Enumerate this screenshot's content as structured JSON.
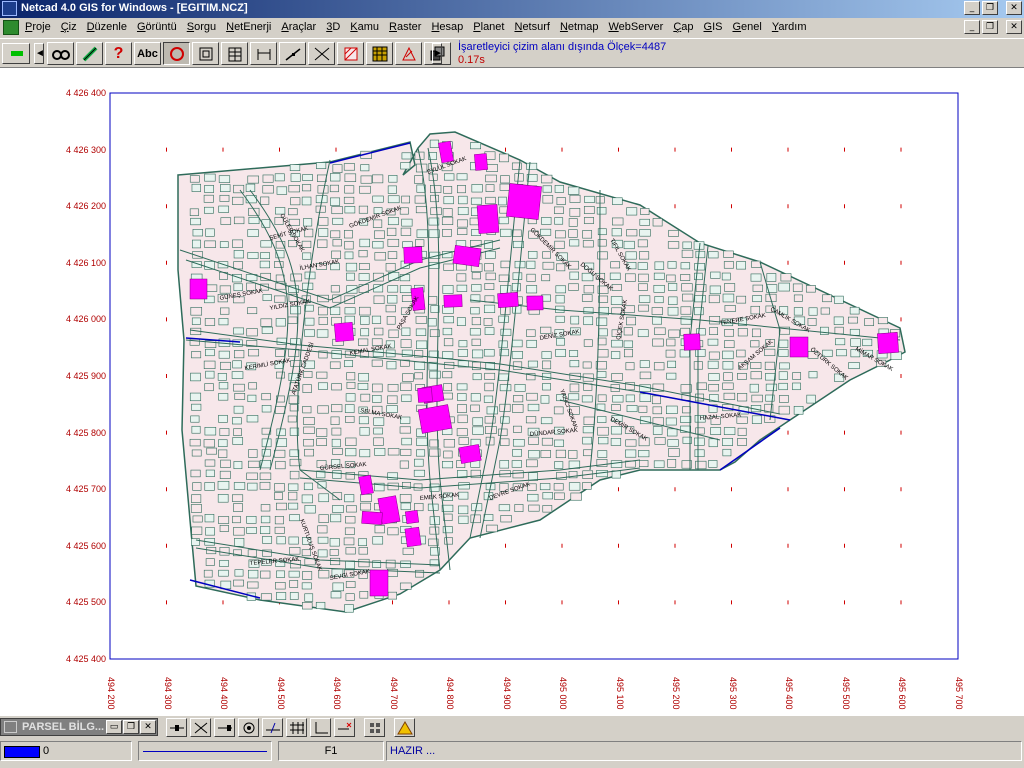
{
  "window": {
    "title": "Netcad 4.0 GIS for Windows - [EGITIM.NCZ]",
    "minimize": "_",
    "restore": "❐",
    "close": "✕"
  },
  "menu": [
    "Proje",
    "Çiz",
    "Düzenle",
    "Görüntü",
    "Sorgu",
    "NetEnerji",
    "Araçlar",
    "3D",
    "Kamu",
    "Raster",
    "Hesap",
    "Planet",
    "Netsurf",
    "Netmap",
    "WebServer",
    "Çap",
    "GIS",
    "Genel",
    "Yardım"
  ],
  "toolbar": {
    "prev_arrow": "◄",
    "next_arrow": "►",
    "abc_label": "Abc",
    "help_label": "?",
    "status_message": "İşaretleyici çizim alanı dışında Ölçek=4487",
    "timing": "0.17s"
  },
  "icons": [
    "binoculars-icon",
    "pencil-icon",
    "help-icon",
    "text-icon",
    "circle-icon",
    "frame-icon",
    "grid-icon",
    "dimension-icon",
    "line-icon",
    "intersect-icon",
    "hatch-icon",
    "raster-icon",
    "polygon-icon",
    "layers-icon"
  ],
  "axes": {
    "y_ticks": [
      "4 426 400",
      "4 426 300",
      "4 426 200",
      "4 426 100",
      "4 426 000",
      "4 425 900",
      "4 425 800",
      "4 425 700",
      "4 425 600",
      "4 425 500",
      "4 425 400"
    ],
    "x_ticks": [
      "494 200",
      "494 300",
      "494 400",
      "494 500",
      "494 600",
      "494 700",
      "494 800",
      "494 900",
      "495 000",
      "495 100",
      "495 200",
      "495 300",
      "495 400",
      "495 500",
      "495 600",
      "495 700"
    ]
  },
  "map": {
    "colors": {
      "parcel_fill": "#f7e7ea",
      "highlight": "#ff00ff",
      "road_line": "#2e6b5a",
      "axis_red": "#b00000",
      "frame_blue": "#0000c0"
    },
    "street_labels": [
      "EYLÜL SOKAK",
      "GÜLER SOKAK",
      "ŞEHİT SOKAK",
      "İLHAN SOKAK",
      "GÖKDEMİR SOKAK",
      "GÖKDEMİR SOKAK",
      "TIFIL SOKAK",
      "TENERE SOKAK",
      "ÇAMLIK SOKAK",
      "ÖZTÜRK SOKAK",
      "DEVRE SOKAK",
      "DEMİR SOKAK",
      "HAZAL SOKAK",
      "AKŞAM SOKAK",
      "YAZICI SOKAK",
      "KERİMLİ SOKAK",
      "ATATÜRK CADDESİ",
      "KEMAL SOKAK",
      "PAŞA SOKAK",
      "SELMA SOKAK",
      "GÜRSEL SOKAK",
      "DÜNDAR SOKAK",
      "EMEK SOKAK",
      "SEVGİ SOKAK",
      "TEPELER SOKAK",
      "GÜNEŞ SOKAK",
      "KURTULUŞ SOKAK",
      "YILDIZ SOKAK",
      "DENİZ SOKAK",
      "DOĞU SOKAK",
      "ÇİÇEK SOKAK",
      "MİMAR SOKAK"
    ]
  },
  "panel": {
    "title": "PARSEL BİLG...",
    "buttons": [
      "▭",
      "❐",
      "✕"
    ]
  },
  "status": {
    "color_index": "0",
    "function_key": "F1",
    "state": "HAZIR ..."
  }
}
